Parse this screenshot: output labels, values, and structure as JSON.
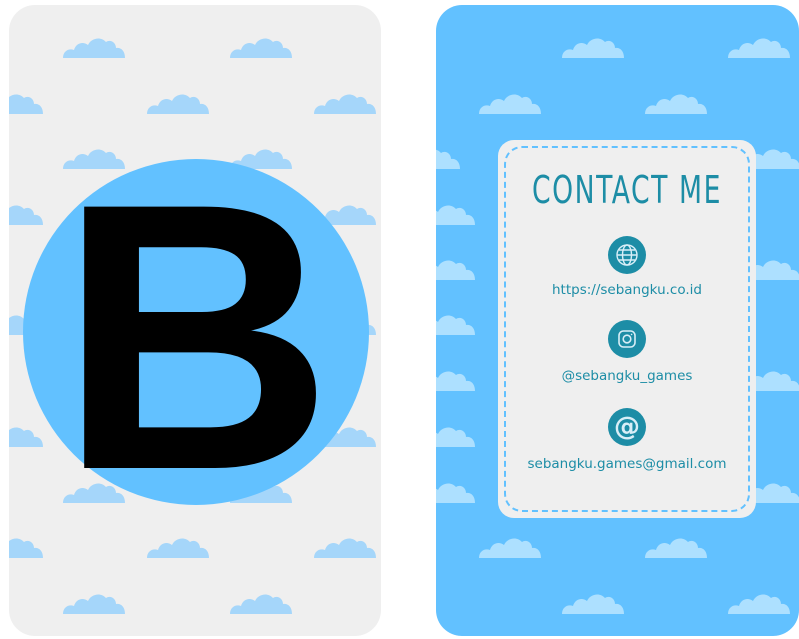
{
  "front": {
    "letter": "B",
    "background_color": "#efefef",
    "circle_color": "#62c1ff",
    "cloud_color": "#a5d6fa",
    "cloud_icon": "cloud-icon"
  },
  "back": {
    "background_color": "#62c1ff",
    "panel_color": "#efefef",
    "accent_color": "#1d8da6",
    "title": "CONTACT ME",
    "contacts": [
      {
        "icon": "globe-icon",
        "text": "https://sebangku.co.id"
      },
      {
        "icon": "instagram-icon",
        "text": "@sebangku_games"
      },
      {
        "icon": "at-sign-icon",
        "text": "sebangku.games@gmail.com"
      }
    ]
  }
}
